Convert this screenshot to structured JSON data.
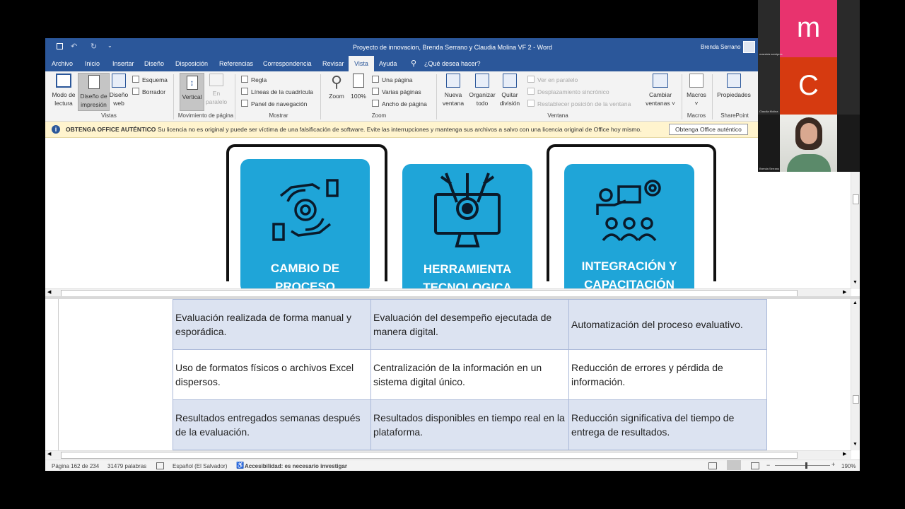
{
  "window": {
    "title": "Proyecto de innovacion, Brenda Serrano y Claudia Molina VF 2  -  Word",
    "user": "Brenda Serrano"
  },
  "tabs": [
    "Archivo",
    "Inicio",
    "Insertar",
    "Diseño",
    "Disposición",
    "Referencias",
    "Correspondencia",
    "Revisar",
    "Vista",
    "Ayuda"
  ],
  "active_tab": "Vista",
  "tell_me": "¿Qué desea hacer?",
  "ribbon": {
    "modo_lectura": [
      "Modo de",
      "lectura"
    ],
    "diseno_impresion": [
      "Diseño de",
      "impresión"
    ],
    "diseno_web": [
      "Diseño",
      "web"
    ],
    "esquema": "Esquema",
    "borrador": "Borrador",
    "group_vistas": "Vistas",
    "vertical": "Vertical",
    "en_paralelo": [
      "En",
      "paralelo"
    ],
    "group_movimiento": "Movimiento de página",
    "regla": "Regla",
    "lineas": "Líneas de la cuadrícula",
    "panel": "Panel de navegación",
    "group_mostrar": "Mostrar",
    "zoom": "Zoom",
    "pct100": "100%",
    "una_pagina": "Una página",
    "varias_paginas": "Varias páginas",
    "ancho_pagina": "Ancho de página",
    "group_zoom": "Zoom",
    "nueva_ventana": [
      "Nueva",
      "ventana"
    ],
    "organizar": [
      "Organizar",
      "todo"
    ],
    "quitar_division": [
      "Quitar",
      "división"
    ],
    "ver_paralelo": "Ver en paralelo",
    "desplazamiento": "Desplazamiento sincrónico",
    "restablecer": "Restablecer posición de la ventana",
    "cambiar": [
      "Cambiar",
      "ventanas ˅"
    ],
    "group_ventana": "Ventana",
    "macros": "Macros",
    "group_macros": "Macros",
    "propiedades": "Propiedades",
    "group_sharepoint": "SharePoint"
  },
  "message_bar": {
    "title": "OBTENGA OFFICE AUTÉNTICO",
    "text": "Su licencia no es original y puede ser víctima de una falsificación de software. Evite las interrupciones y mantenga sus archivos a salvo con una licencia original de Office hoy mismo.",
    "button": "Obtenga Office auténtico"
  },
  "cards": [
    {
      "title": "CAMBIO DE",
      "title2": "PROCESO"
    },
    {
      "title": "HERRAMIENTA",
      "title2": "TECNOLOGICA"
    },
    {
      "title": "INTEGRACIÓN Y",
      "title2": "CAPACITACIÓN"
    }
  ],
  "table": [
    [
      "Evaluación realizada de forma manual y esporádica.",
      "Evaluación del desempeño ejecutada de manera digital.",
      "Automatización del proceso evaluativo."
    ],
    [
      "Uso de formatos físicos o archivos Excel dispersos.",
      "Centralización de la información en un sistema digital único.",
      "Reducción de errores y pérdida de información."
    ],
    [
      "Resultados entregados semanas después de la evaluación.",
      "Resultados disponibles en tiempo real en la plataforma.",
      "Reducción significativa del tiempo de entrega de resultados."
    ]
  ],
  "status": {
    "page": "Página 162 de 234",
    "words": "31479 palabras",
    "language": "Español (El Salvador)",
    "accessibility": "Accesibilidad: es necesario investigar",
    "zoom": "190%"
  },
  "participants": [
    {
      "initial": "m",
      "name": "maestria semipres",
      "color": "#e8336e"
    },
    {
      "initial": "C",
      "name": "Claudia Molina",
      "color": "#d63a10"
    },
    {
      "name": "Brenda Serrano"
    }
  ]
}
